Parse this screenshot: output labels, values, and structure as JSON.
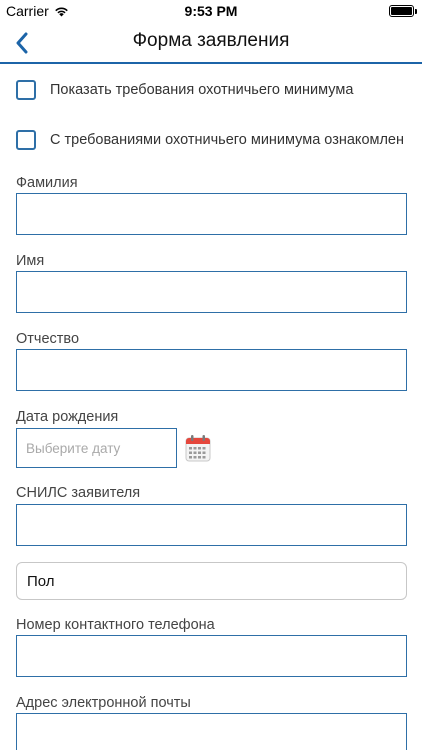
{
  "status_bar": {
    "carrier": "Carrier",
    "time": "9:53 PM",
    "wifi_icon": "wifi-icon",
    "battery_icon": "battery-icon"
  },
  "nav": {
    "title": "Форма заявления",
    "back_icon": "chevron-left-icon"
  },
  "checkboxes": [
    {
      "label": "Показать требования охотничьего минимума",
      "checked": false
    },
    {
      "label": "С требованиями охотничьего минимума ознакомлен",
      "checked": false
    }
  ],
  "fields": {
    "last_name": {
      "label": "Фамилия",
      "value": ""
    },
    "first_name": {
      "label": "Имя",
      "value": ""
    },
    "patronymic": {
      "label": "Отчество",
      "value": ""
    },
    "birth_date": {
      "label": "Дата рождения",
      "placeholder": "Выберите дату",
      "value": "",
      "calendar_icon": "calendar-icon"
    },
    "snils": {
      "label": "СНИЛС заявителя",
      "value": ""
    },
    "gender": {
      "value": "Пол"
    },
    "phone": {
      "label": "Номер контактного телефона",
      "value": ""
    },
    "email": {
      "label": "Адрес электронной почты",
      "value": ""
    }
  },
  "colors": {
    "accent": "#1c64a8",
    "field_border": "#2e6fa7",
    "calendar_red": "#e5473c"
  }
}
